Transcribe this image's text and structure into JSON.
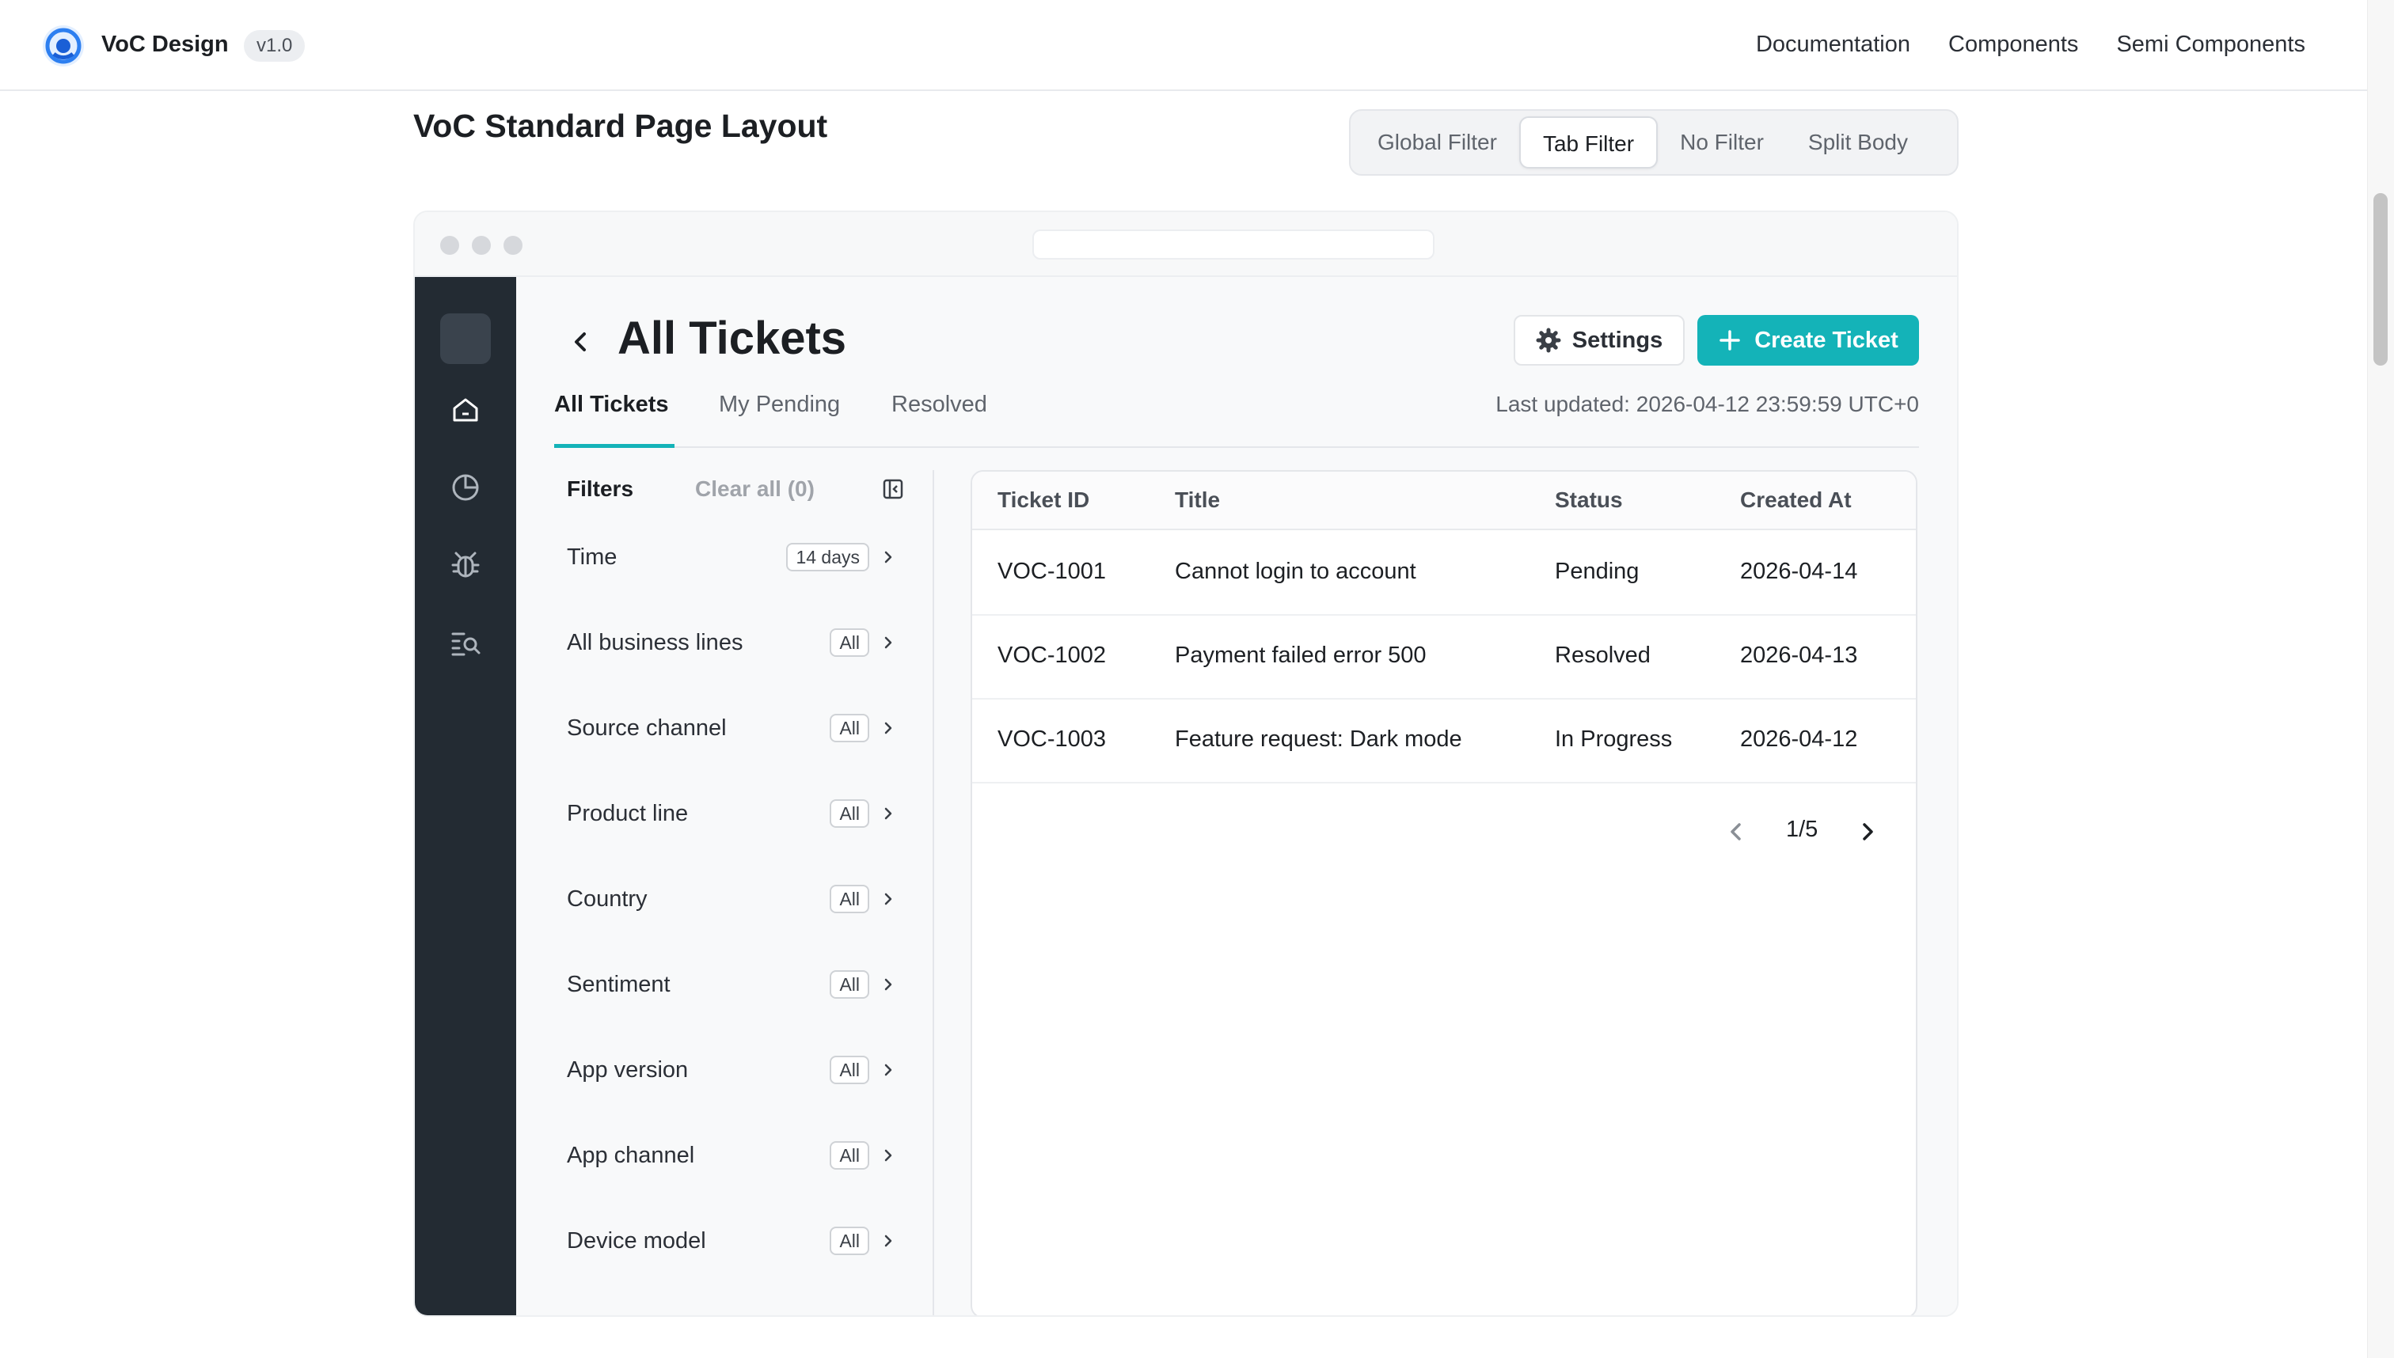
{
  "topnav": {
    "brand": "VoC Design",
    "version": "v1.0",
    "links": [
      "Documentation",
      "Components",
      "Semi Components"
    ]
  },
  "page": {
    "title": "VoC Standard Page Layout",
    "layout_options": [
      "Global Filter",
      "Tab Filter",
      "No Filter",
      "Split Body"
    ],
    "active_layout": "Tab Filter"
  },
  "app": {
    "title": "All Tickets",
    "settings_label": "Settings",
    "create_label": "Create Ticket",
    "tabs": [
      "All Tickets",
      "My Pending",
      "Resolved"
    ],
    "active_tab": "All Tickets",
    "last_updated": "Last updated: 2026-04-12 23:59:59 UTC+0",
    "sidebar_icons": [
      "home-icon",
      "pie-chart-icon",
      "bug-icon",
      "search-list-icon"
    ],
    "accent_color": "#14b3b8"
  },
  "filters": {
    "heading": "Filters",
    "clear": "Clear all (0)",
    "items": [
      {
        "label": "Time",
        "value": "14 days"
      },
      {
        "label": "All business lines",
        "value": "All"
      },
      {
        "label": "Source channel",
        "value": "All"
      },
      {
        "label": "Product line",
        "value": "All"
      },
      {
        "label": "Country",
        "value": "All"
      },
      {
        "label": "Sentiment",
        "value": "All"
      },
      {
        "label": "App version",
        "value": "All"
      },
      {
        "label": "App channel",
        "value": "All"
      },
      {
        "label": "Device model",
        "value": "All"
      }
    ]
  },
  "table": {
    "columns": [
      "Ticket ID",
      "Title",
      "Status",
      "Created At"
    ],
    "rows": [
      [
        "VOC-1001",
        "Cannot login to account",
        "Pending",
        "2026-04-14"
      ],
      [
        "VOC-1002",
        "Payment failed error 500",
        "Resolved",
        "2026-04-13"
      ],
      [
        "VOC-1003",
        "Feature request: Dark mode",
        "In Progress",
        "2026-04-12"
      ]
    ],
    "pagination": "1/5"
  }
}
